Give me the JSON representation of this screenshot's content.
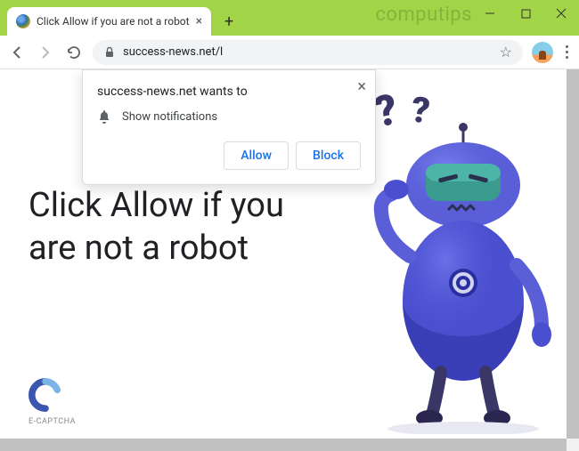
{
  "window": {
    "watermark": "computips"
  },
  "tab": {
    "title": "Click Allow if you are not a robot"
  },
  "address_bar": {
    "url": "success-news.net/l"
  },
  "permission_popup": {
    "site_wants_to": "success-news.net wants to",
    "permission": "Show notifications",
    "allow": "Allow",
    "block": "Block"
  },
  "page": {
    "headline": "Click Allow if you are not a robot",
    "brand": "E-CAPTCHA",
    "question_marks": "??"
  },
  "colors": {
    "titlebar": "#a1d447",
    "robot_body": "#5a5fd8",
    "robot_visor": "#3a9b8f",
    "link_blue": "#1a73e8"
  }
}
